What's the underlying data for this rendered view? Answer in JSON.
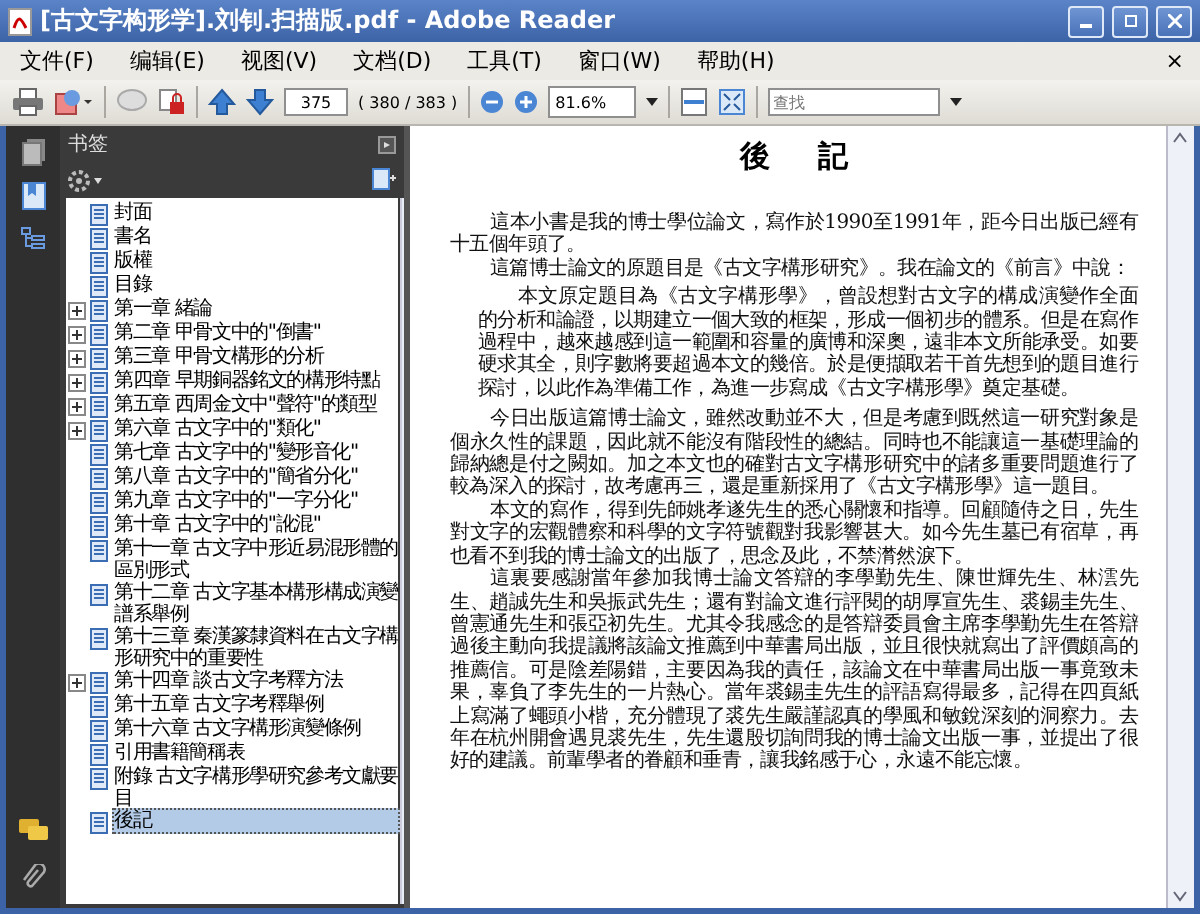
{
  "window": {
    "title": "[古文字构形学].刘钊.扫描版.pdf - Adobe Reader"
  },
  "menu": {
    "items": [
      "文件(F)",
      "编辑(E)",
      "视图(V)",
      "文档(D)",
      "工具(T)",
      "窗口(W)",
      "帮助(H)"
    ],
    "close": "×"
  },
  "toolbar": {
    "page_field": "375",
    "page_count": "( 380 / 383 )",
    "zoom": "81.6%",
    "search": {
      "placeholder": "查找"
    }
  },
  "sidebar": {
    "title": "书签",
    "bookmarks": [
      {
        "label": "封面",
        "expandable": false,
        "selected": false
      },
      {
        "label": "書名",
        "expandable": false,
        "selected": false
      },
      {
        "label": "版權",
        "expandable": false,
        "selected": false
      },
      {
        "label": "目錄",
        "expandable": false,
        "selected": false
      },
      {
        "label": "第一章 緒論",
        "expandable": true,
        "selected": false
      },
      {
        "label": "第二章 甲骨文中的\"倒書\"",
        "expandable": true,
        "selected": false
      },
      {
        "label": "第三章 甲骨文構形的分析",
        "expandable": true,
        "selected": false
      },
      {
        "label": "第四章 早期銅器銘文的構形特點",
        "expandable": true,
        "selected": false
      },
      {
        "label": "第五章 西周金文中\"聲符\"的類型",
        "expandable": true,
        "selected": false
      },
      {
        "label": "第六章 古文字中的\"類化\"",
        "expandable": true,
        "selected": false
      },
      {
        "label": "第七章 古文字中的\"變形音化\"",
        "expandable": false,
        "selected": false
      },
      {
        "label": "第八章 古文字中的\"簡省分化\"",
        "expandable": false,
        "selected": false
      },
      {
        "label": "第九章 古文字中的\"一字分化\"",
        "expandable": false,
        "selected": false
      },
      {
        "label": "第十章 古文字中的\"訛混\"",
        "expandable": false,
        "selected": false
      },
      {
        "label": "第十一章 古文字中形近易混形體的區別形式",
        "expandable": false,
        "selected": false
      },
      {
        "label": "第十二章 古文字基本構形構成演變譜系舉例",
        "expandable": false,
        "selected": false
      },
      {
        "label": "第十三章 秦漢篆隸資料在古文字構形研究中的重要性",
        "expandable": false,
        "selected": false
      },
      {
        "label": "第十四章 談古文字考釋方法",
        "expandable": true,
        "selected": false
      },
      {
        "label": "第十五章 古文字考釋舉例",
        "expandable": false,
        "selected": false
      },
      {
        "label": "第十六章 古文字構形演變條例",
        "expandable": false,
        "selected": false
      },
      {
        "label": "引用書籍簡稱表",
        "expandable": false,
        "selected": false
      },
      {
        "label": "附錄 古文字構形學研究參考文獻要目",
        "expandable": false,
        "selected": false
      },
      {
        "label": "後記",
        "expandable": false,
        "selected": true
      }
    ]
  },
  "document": {
    "title": "後記",
    "paragraphs": [
      {
        "kind": "body",
        "text": "這本小書是我的博士學位論文，寫作於1990至1991年，距今日出版已經有十五個年頭了。"
      },
      {
        "kind": "body",
        "text": "這篇博士論文的原題目是《古文字構形研究》。我在論文的《前言》中說："
      },
      {
        "kind": "quote",
        "text": "本文原定題目為《古文字構形學》，曾設想對古文字的構成演變作全面的分析和論證，以期建立一個大致的框架，形成一個初步的體系。但是在寫作過程中，越來越感到這一範圍和容量的廣博和深奧，遠非本文所能承受。如要硬求其全，則字數將要超過本文的幾倍。於是便擷取若干首先想到的題目進行探討，以此作為準備工作，為進一步寫成《古文字構形學》奠定基礎。"
      },
      {
        "kind": "body",
        "text": "今日出版這篇博士論文，雖然改動並不大，但是考慮到既然這一研究對象是個永久性的課題，因此就不能沒有階段性的總結。同時也不能讓這一基礎理論的歸納總是付之闕如。加之本文也的確對古文字構形研究中的諸多重要問題進行了較為深入的探討，故考慮再三，還是重新採用了《古文字構形學》這一題目。"
      },
      {
        "kind": "body",
        "text": "本文的寫作，得到先師姚孝遂先生的悉心關懷和指導。回顧隨侍之日，先生對文字的宏觀體察和科學的文字符號觀對我影響甚大。如今先生墓已有宿草，再也看不到我的博士論文的出版了，思念及此，不禁潸然淚下。"
      },
      {
        "kind": "body",
        "text": "這裏要感謝當年參加我博士論文答辯的李學勤先生、陳世輝先生、林澐先生、趙誠先生和吳振武先生；還有對論文進行評閱的胡厚宣先生、裘錫圭先生、曾憲通先生和張亞初先生。尤其令我感念的是答辯委員會主席李學勤先生在答辯過後主動向我提議將該論文推薦到中華書局出版，並且很快就寫出了評價頗高的推薦信。可是陰差陽錯，主要因為我的責任，該論文在中華書局出版一事竟致未果，辜負了李先生的一片熱心。當年裘錫圭先生的評語寫得最多，記得在四頁紙上寫滿了蠅頭小楷，充分體現了裘先生嚴謹認真的學風和敏銳深刻的洞察力。去年在杭州開會遇見裘先生，先生還殷切詢問我的博士論文出版一事，並提出了很好的建議。前輩學者的眷顧和垂青，讓我銘感于心，永遠不能忘懷。"
      }
    ]
  }
}
